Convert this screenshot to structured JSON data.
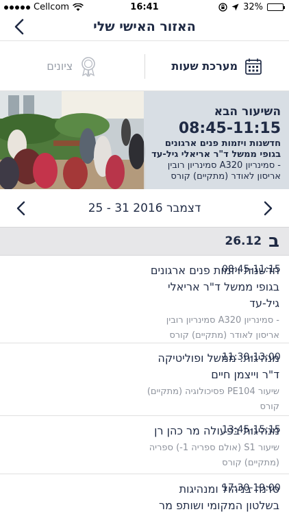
{
  "status_bar": {
    "carrier": "Cellcom",
    "time": "16:41",
    "battery": "32%",
    "battery_level": 0.32
  },
  "nav": {
    "title": "האזור האישי שלי"
  },
  "segment": {
    "grades_label": "ציונים",
    "schedule_label": "מערכת שעות"
  },
  "next_class": {
    "label": "השיעור הבא",
    "time": "08:45-11:15",
    "course": "חדשנות ויזמות פנים ארגונים בגופי ממשל ד\"ר אריאלי גיל-עד",
    "location": "- סמינריון A320 סמינריון רובין אריסון לאודר (מתקיים) קורס"
  },
  "week": {
    "label": "25 - 31 דצמבר 2016"
  },
  "day": {
    "letter": "ב",
    "date": "26.12"
  },
  "classes": [
    {
      "time": "08:45-11:15",
      "course_lines": [
        "חדשנות ויזמות פנים ארגונים",
        "בגופי ממשל ד\"ר אריאלי",
        "גיל-עד"
      ],
      "location_lines": [
        "- סמינריון A320 סמינריון רובין",
        "אריסון לאודר (מתקיים) קורס"
      ]
    },
    {
      "time": "11:30-13:00",
      "course_lines": [
        "מנהיגות: ממשל ופוליטיקה",
        "ד\"ר וייצמן חיים"
      ],
      "location_lines": [
        "שיעור PE104 פסיכולוגיה (מתקיים)",
        "קורס"
      ]
    },
    {
      "time": "13:45-15:15",
      "course_lines": [
        "מנהיגות בפעולה מר כהן רן"
      ],
      "location_lines": [
        "שיעור S1 (אולם ספריה 1-) ספריה",
        "(מתקיים) קורס"
      ]
    },
    {
      "time": "17:30-19:00",
      "course_lines": [
        "סדנה בניהול ומנהיגות",
        "בשלטון המקומי ושותפ מר"
      ],
      "location_lines": []
    }
  ]
}
